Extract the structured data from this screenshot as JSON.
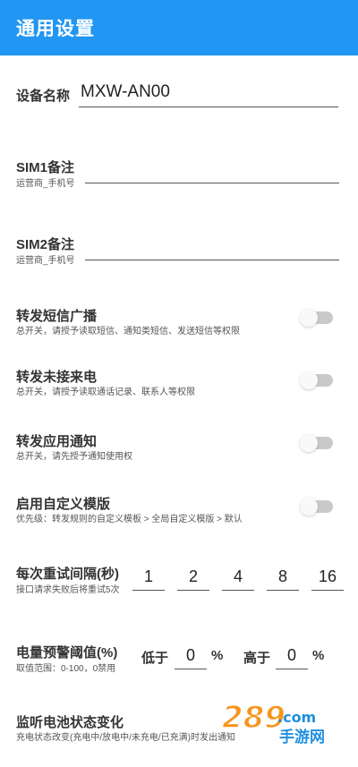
{
  "appbar": {
    "title": "通用设置"
  },
  "device_name": {
    "label": "设备名称",
    "value": "MXW-AN00"
  },
  "sim1": {
    "label": "SIM1备注",
    "hint": "运营商_手机号",
    "value": ""
  },
  "sim2": {
    "label": "SIM2备注",
    "hint": "运营商_手机号",
    "value": ""
  },
  "forward_sms": {
    "label": "转发短信广播",
    "desc": "总开关，请授予读取短信、通知类短信、发送短信等权限",
    "enabled": false
  },
  "forward_missed_call": {
    "label": "转发未接来电",
    "desc": "总开关，请授予读取通话记录、联系人等权限",
    "enabled": false
  },
  "forward_app_notify": {
    "label": "转发应用通知",
    "desc": "总开关，请先授予通知使用权",
    "enabled": false
  },
  "custom_template": {
    "label": "启用自定义模版",
    "desc": "优先级：转发规则的自定义模板 > 全局自定义模版 > 默认",
    "enabled": false
  },
  "retry": {
    "label": "每次重试间隔(秒)",
    "desc": "接口请求失败后将重试5次",
    "values": [
      "1",
      "2",
      "4",
      "8",
      "16"
    ]
  },
  "battery": {
    "label": "电量预警阈值(%)",
    "desc": "取值范围：0-100，0禁用",
    "low_label": "低于",
    "low_value": "0",
    "low_unit": "%",
    "high_label": "高于",
    "high_value": "0",
    "high_unit": "%"
  },
  "battery_monitor": {
    "label": "监听电池状态变化",
    "desc": "充电状态改变(充电中/放电中/未充电/已充满)时发出通知"
  },
  "watermark": {
    "text": "289.com",
    "subtext": "手游网",
    "colors": {
      "orange": "#f7941d",
      "blue": "#1f8fe0"
    }
  }
}
